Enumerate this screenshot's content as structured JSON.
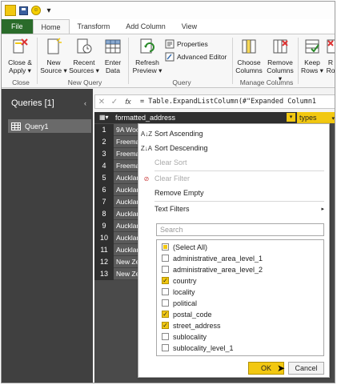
{
  "titlebar": {
    "qat_dropdown": "▾"
  },
  "tabs": [
    {
      "label": "File"
    },
    {
      "label": "Home"
    },
    {
      "label": "Transform"
    },
    {
      "label": "Add Column"
    },
    {
      "label": "View"
    }
  ],
  "ribbon": {
    "close_apply": "Close &",
    "close_apply2": "Apply ▾",
    "close_group": "Close",
    "new_source": "New",
    "new_source2": "Source ▾",
    "recent_sources": "Recent",
    "recent_sources2": "Sources ▾",
    "enter_data": "Enter",
    "enter_data2": "Data",
    "new_query_group": "New Query",
    "refresh": "Refresh",
    "refresh2": "Preview ▾",
    "properties": "Properties",
    "advanced_editor": "Advanced Editor",
    "query_group": "Query",
    "choose_columns": "Choose",
    "choose_columns2": "Columns",
    "remove_columns": "Remove",
    "remove_columns2": "Columns ▾",
    "manage_group": "Manage Columns",
    "keep_rows": "Keep",
    "keep_rows2": "Rows ▾",
    "remove_rows": "R",
    "remove_rows2": "Ro"
  },
  "queries": {
    "header": "Queries [1]",
    "collapse": "‹",
    "items": [
      {
        "label": "Query1"
      }
    ]
  },
  "formula": {
    "cancel": "✕",
    "accept": "✓",
    "fx": "fx",
    "text": "= Table.ExpandListColumn(#\"Expanded Column1"
  },
  "grid": {
    "corner": "▦▾",
    "columns": [
      {
        "label": "formatted_address",
        "filter": "▾"
      },
      {
        "label": "types",
        "filter": "▾"
      }
    ],
    "rows": [
      {
        "num": "1",
        "cell": "9A Woo"
      },
      {
        "num": "2",
        "cell": "Freema"
      },
      {
        "num": "3",
        "cell": "Freema"
      },
      {
        "num": "4",
        "cell": "Freema"
      },
      {
        "num": "5",
        "cell": "Auckland"
      },
      {
        "num": "6",
        "cell": "Auckland"
      },
      {
        "num": "7",
        "cell": "Auckland"
      },
      {
        "num": "8",
        "cell": "Auckland"
      },
      {
        "num": "9",
        "cell": "Auckland"
      },
      {
        "num": "10",
        "cell": "Auckland"
      },
      {
        "num": "11",
        "cell": "Auckland"
      },
      {
        "num": "12",
        "cell": "New Zea"
      },
      {
        "num": "13",
        "cell": "New Zea"
      }
    ]
  },
  "dropdown": {
    "sort_ascending": "Sort Ascending",
    "sort_descending": "Sort Descending",
    "clear_sort": "Clear Sort",
    "clear_filter": "Clear Filter",
    "remove_empty": "Remove Empty",
    "text_filters": "Text Filters",
    "submenu_arrow": "▸",
    "search_placeholder": "Search",
    "items": [
      {
        "label": "(Select All)",
        "state": "partial"
      },
      {
        "label": "administrative_area_level_1",
        "state": "unchecked"
      },
      {
        "label": "administrative_area_level_2",
        "state": "unchecked"
      },
      {
        "label": "country",
        "state": "checked"
      },
      {
        "label": "locality",
        "state": "unchecked"
      },
      {
        "label": "political",
        "state": "unchecked"
      },
      {
        "label": "postal_code",
        "state": "checked"
      },
      {
        "label": "street_address",
        "state": "checked"
      },
      {
        "label": "sublocality",
        "state": "unchecked"
      },
      {
        "label": "sublocality_level_1",
        "state": "unchecked"
      }
    ],
    "ok": "OK",
    "cancel": "Cancel"
  },
  "colors": {
    "accent": "#f2c811",
    "file_tab": "#2a6b2a",
    "pane": "#404040"
  }
}
